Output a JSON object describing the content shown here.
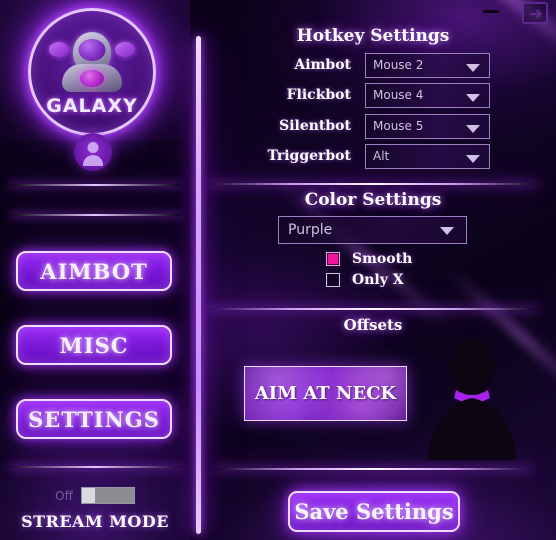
{
  "window": {
    "minimize_icon": "minimize-icon",
    "exit_icon": "exit-icon"
  },
  "sidebar": {
    "logo_text": "GALAXY",
    "logo_icon": "astronaut-logo-icon",
    "avatar_icon": "user-avatar-icon",
    "nav_items": [
      {
        "label": "AIMBOT"
      },
      {
        "label": "MISC"
      },
      {
        "label": "SETTINGS"
      }
    ],
    "stream_mode": {
      "state_label": "Off",
      "title": "STREAM MODE",
      "enabled": false
    }
  },
  "main": {
    "hotkey_section": {
      "title": "Hotkey Settings",
      "rows": [
        {
          "label": "Aimbot",
          "value": "Mouse 2"
        },
        {
          "label": "Flickbot",
          "value": "Mouse 4"
        },
        {
          "label": "Silentbot",
          "value": "Mouse 5"
        },
        {
          "label": "Triggerbot",
          "value": "Alt"
        }
      ]
    },
    "color_section": {
      "title": "Color Settings",
      "color_value": "Purple",
      "checkboxes": [
        {
          "label": "Smooth",
          "checked": true
        },
        {
          "label": "Only X",
          "checked": false
        }
      ]
    },
    "offsets_section": {
      "title": "Offsets",
      "aim_button_label": "AIM AT NECK",
      "silhouette_icon": "player-silhouette-icon"
    },
    "save_button_label": "Save Settings"
  },
  "colors": {
    "accent_purple": "#9b2cf5",
    "neon_glow": "#b447ff",
    "checkbox_checked": "#f0139c",
    "text_primary": "#ffffff",
    "dropdown_text": "#cfc2e0",
    "background_dark": "#0a0216"
  }
}
